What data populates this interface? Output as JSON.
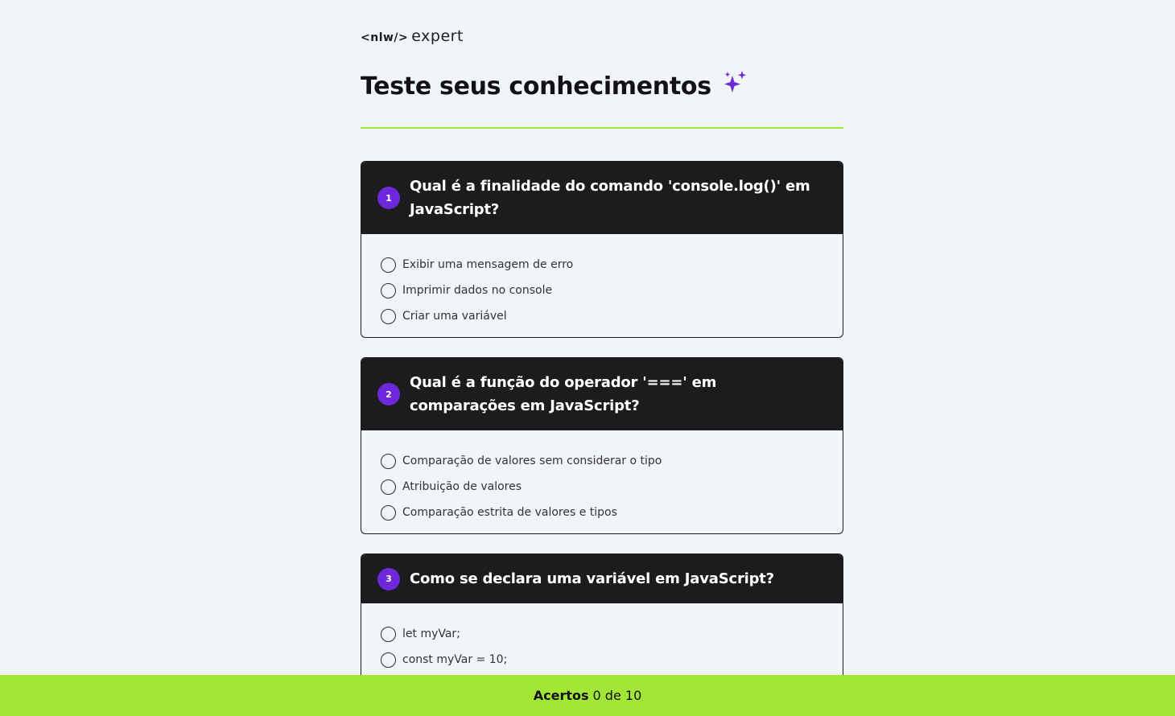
{
  "logo": {
    "tag": "<nlw/>",
    "word": "expert"
  },
  "title": "Teste seus conhecimentos",
  "colors": {
    "accent": "#a3e635",
    "purple": "#6d28d9",
    "dark": "#1c1c1e",
    "background": "#f1f4f9"
  },
  "questions": [
    {
      "number": "1",
      "text": "Qual é a finalidade do comando 'console.log()' em JavaScript?",
      "options": [
        "Exibir uma mensagem de erro",
        "Imprimir dados no console",
        "Criar uma variável"
      ]
    },
    {
      "number": "2",
      "text": "Qual é a função do operador '===' em comparações em JavaScript?",
      "options": [
        "Comparação de valores sem considerar o tipo",
        "Atribuição de valores",
        "Comparação estrita de valores e tipos"
      ]
    },
    {
      "number": "3",
      "text": "Como se declara uma variável em JavaScript?",
      "options": [
        "let myVar;",
        "const myVar = 10;"
      ]
    }
  ],
  "footer": {
    "label": "Acertos",
    "score": "0 de 10"
  }
}
